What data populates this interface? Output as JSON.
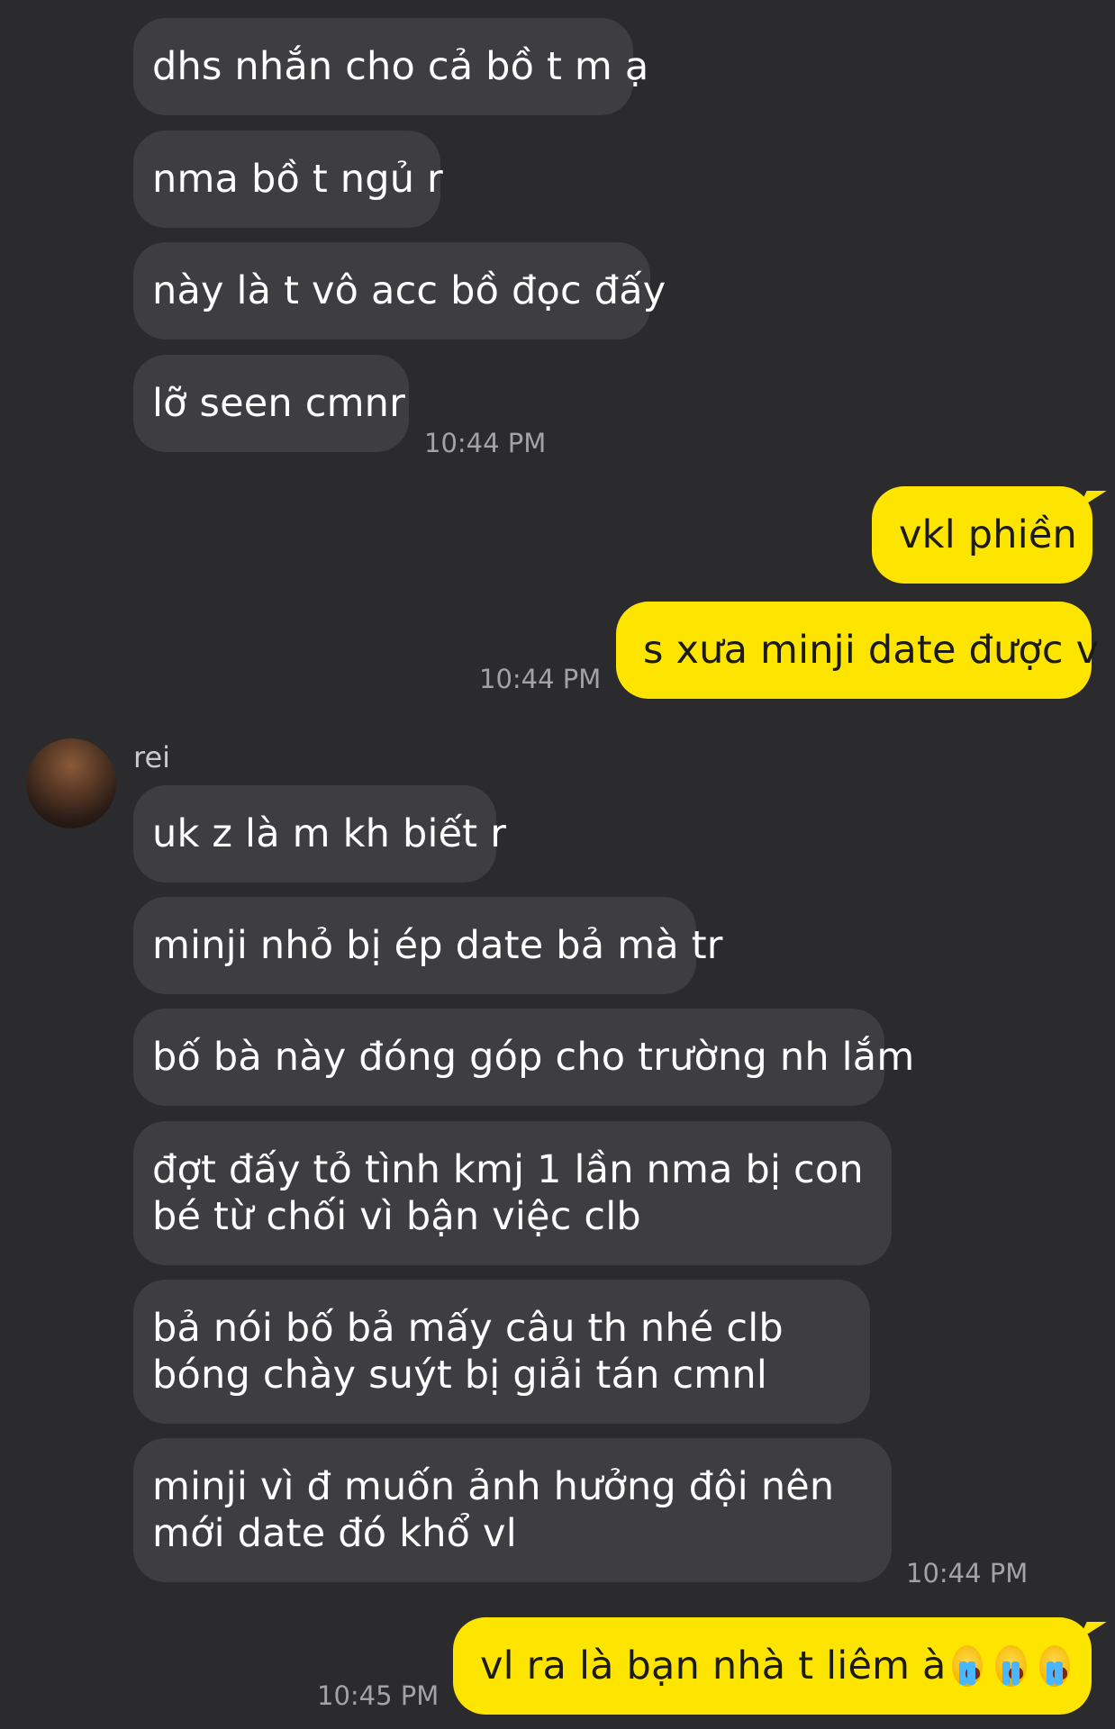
{
  "top_group": {
    "messages": [
      "dhs nhắn cho cả bồ t m ạ",
      "nma bồ t ngủ r",
      "này là t vô acc bồ đọc đấy",
      "lỡ seen cmnr"
    ],
    "time": "10:44 PM"
  },
  "my_group_1": {
    "messages": [
      "vkl phiền",
      "s xưa minji date được v"
    ],
    "time": "10:44 PM"
  },
  "contact": {
    "name": "rei",
    "avatar_icon": "avatar-photo"
  },
  "rei_group": {
    "messages": [
      "uk z là m kh biết r",
      "minji nhỏ bị ép date bả mà tr",
      "bố bà này đóng góp cho trường nh lắm",
      "đợt đấy tỏ tình kmj 1 lần nma bị con bé từ chối vì bận việc clb",
      "bả nói bố bả mấy câu th nhé clb bóng chày suýt bị giải tán cmnl",
      "minji vì đ muốn ảnh hưởng đội nên mới date đó khổ vl"
    ],
    "time": "10:44 PM"
  },
  "my_group_2": {
    "message": "vl ra là bạn nhà t liêm à",
    "emojis": [
      "loudly-crying-face",
      "loudly-crying-face",
      "loudly-crying-face"
    ],
    "time": "10:45 PM"
  },
  "colors": {
    "background": "#2b2b2d",
    "incoming_bubble": "#3e3e41",
    "outgoing_bubble": "#fee500",
    "timestamp": "#a3a3a7"
  }
}
